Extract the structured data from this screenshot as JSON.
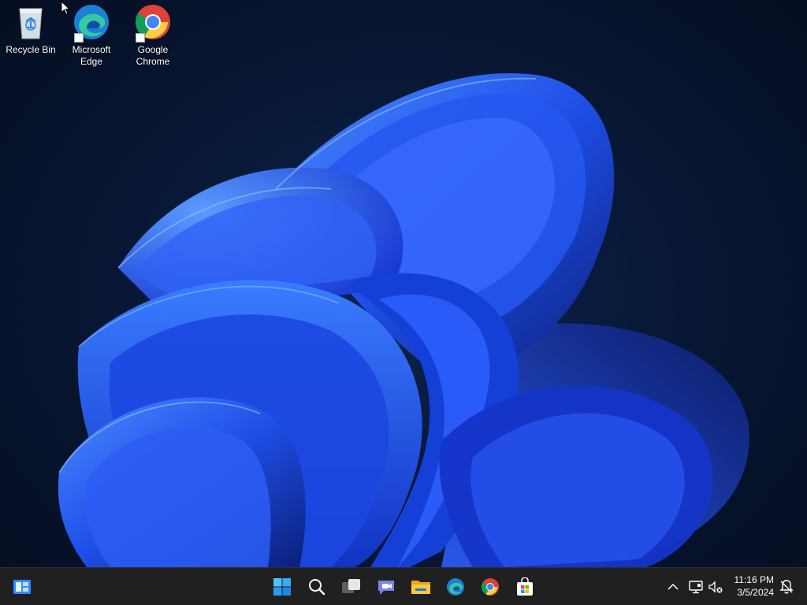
{
  "desktop": {
    "icons": [
      {
        "label": "Recycle Bin",
        "icon": "recycle-bin-icon"
      },
      {
        "label": "Microsoft\nEdge",
        "icon": "edge-icon"
      },
      {
        "label": "Google\nChrome",
        "icon": "chrome-icon"
      }
    ]
  },
  "taskbar": {
    "left": [
      {
        "icon": "widgets-icon"
      }
    ],
    "center": [
      {
        "icon": "windows-start-icon"
      },
      {
        "icon": "search-icon"
      },
      {
        "icon": "task-view-icon"
      },
      {
        "icon": "teams-chat-icon"
      },
      {
        "icon": "file-explorer-icon"
      },
      {
        "icon": "edge-icon"
      },
      {
        "icon": "chrome-icon"
      },
      {
        "icon": "microsoft-store-icon"
      }
    ],
    "tray": {
      "time": "11:16 PM",
      "date": "3/5/2024",
      "icons": [
        "chevron-up-icon",
        "network-icon",
        "volume-muted-icon",
        "notification-icon"
      ]
    }
  },
  "colors": {
    "taskbar_bg": "#202020",
    "desktop_bg": "#081836",
    "bloom_blue": "#1f4fe8"
  }
}
